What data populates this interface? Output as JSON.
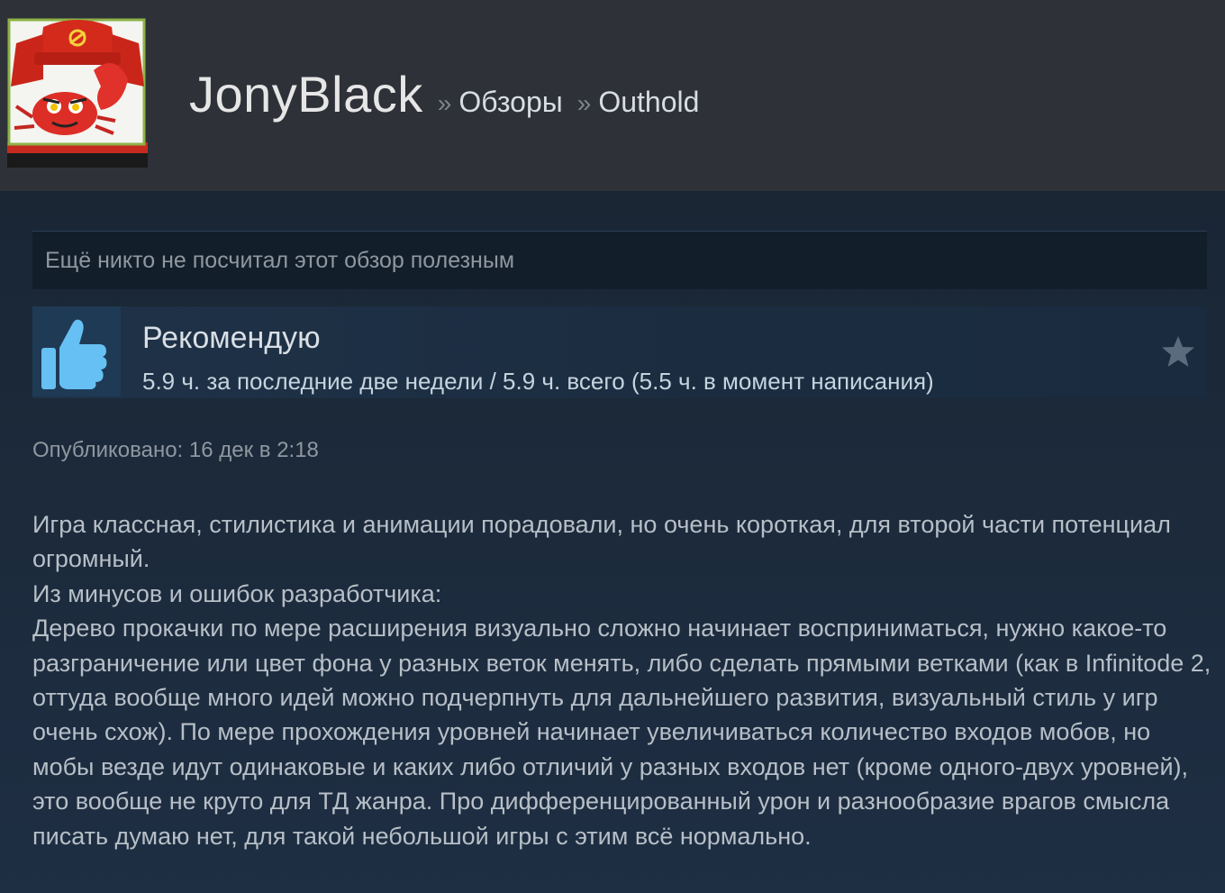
{
  "header": {
    "user_name": "JonyBlack",
    "separator": "»",
    "crumb_reviews": "Обзоры",
    "crumb_game": "Outhold",
    "avatar_icon": "avatar-crab-with-ushanka-icon"
  },
  "review": {
    "helpful_text": "Ещё никто не посчитал этот обзор полезным",
    "verdict": "Рекомендую",
    "verdict_icon": "thumbs-up-icon",
    "hours": "5.9 ч. за последние две недели / 5.9 ч. всего (5.5 ч. в момент написания)",
    "award_icon": "star-icon",
    "posted": "Опубликовано: 16 дек в 2:18",
    "body": [
      "Игра классная, стилистика и анимации порадовали, но очень короткая, для второй части потенциал огромный.",
      "Из минусов и ошибок разработчика:",
      "Дерево прокачки по мере расширения визуально сложно начинает восприниматься, нужно какое-то разграничение или цвет фона у разных веток менять, либо сделать прямыми ветками (как в Infinitode 2, оттуда вообще много идей можно подчерпнуть для дальнейшего развития, визуальный стиль у игр очень схож). По мере прохождения уровней начинает увеличиваться количество входов мобов, но мобы везде идут одинаковые и каких либо отличий у разных входов нет (кроме одного-двух уровней), это вообще не круто для ТД жанра. Про дифференцированный урон и разнообразие врагов смысла писать думаю нет, для такой небольшой игры с этим всё нормально."
    ]
  },
  "colors": {
    "header_bg": "#2e3138",
    "page_bg": "#1b2838",
    "thumb_blue": "#66c0f4"
  }
}
